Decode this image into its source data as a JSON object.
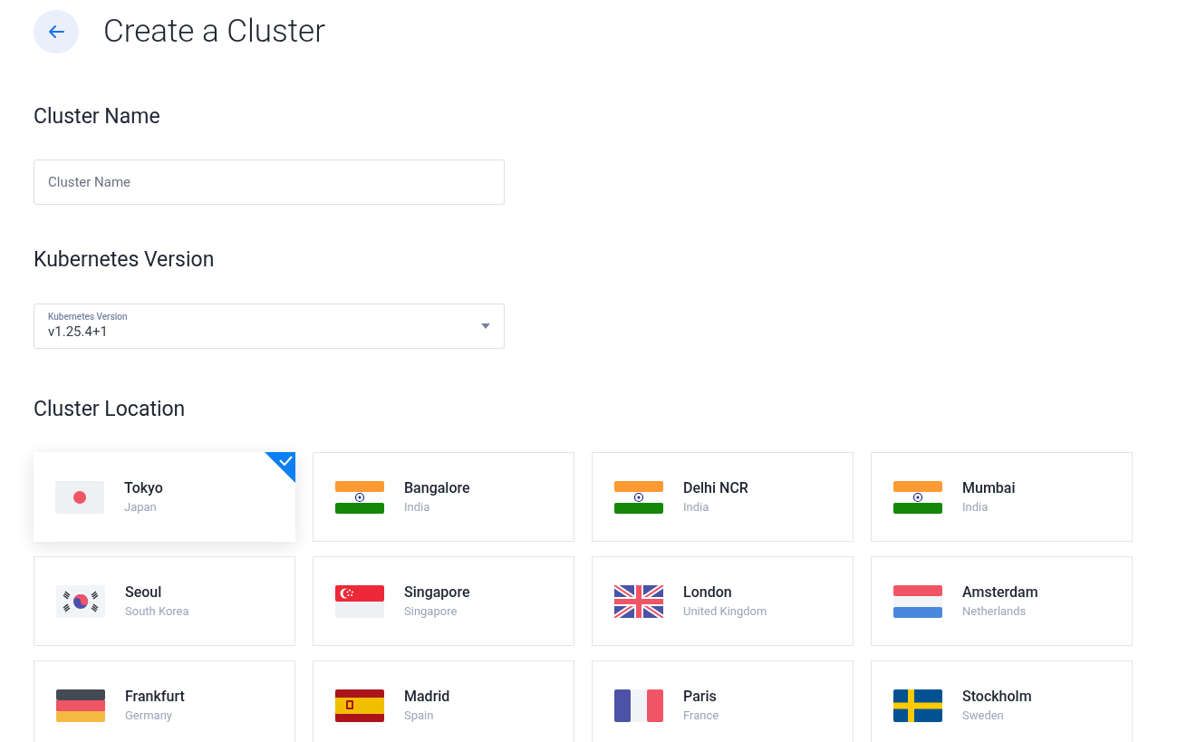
{
  "page": {
    "title": "Create a Cluster"
  },
  "name_section": {
    "heading": "Cluster Name",
    "field": {
      "placeholder": "Cluster Name"
    }
  },
  "version_section": {
    "heading": "Kubernetes Version",
    "select": {
      "label": "Kubernetes Version",
      "value": "v1.25.4+1"
    }
  },
  "location_section": {
    "heading": "Cluster Location",
    "locations": [
      {
        "city": "Tokyo",
        "country": "Japan",
        "kind": "jp",
        "selected": true
      },
      {
        "city": "Bangalore",
        "country": "India",
        "kind": "in",
        "selected": false
      },
      {
        "city": "Delhi NCR",
        "country": "India",
        "kind": "in",
        "selected": false
      },
      {
        "city": "Mumbai",
        "country": "India",
        "kind": "in",
        "selected": false
      },
      {
        "city": "Seoul",
        "country": "South Korea",
        "kind": "kr",
        "selected": false
      },
      {
        "city": "Singapore",
        "country": "Singapore",
        "kind": "sg",
        "selected": false
      },
      {
        "city": "London",
        "country": "United Kingdom",
        "kind": "gb",
        "selected": false
      },
      {
        "city": "Amsterdam",
        "country": "Netherlands",
        "kind": "nl",
        "selected": false
      },
      {
        "city": "Frankfurt",
        "country": "Germany",
        "kind": "de",
        "selected": false
      },
      {
        "city": "Madrid",
        "country": "Spain",
        "kind": "es",
        "selected": false
      },
      {
        "city": "Paris",
        "country": "France",
        "kind": "fr",
        "selected": false
      },
      {
        "city": "Stockholm",
        "country": "Sweden",
        "kind": "se",
        "selected": false
      }
    ]
  }
}
